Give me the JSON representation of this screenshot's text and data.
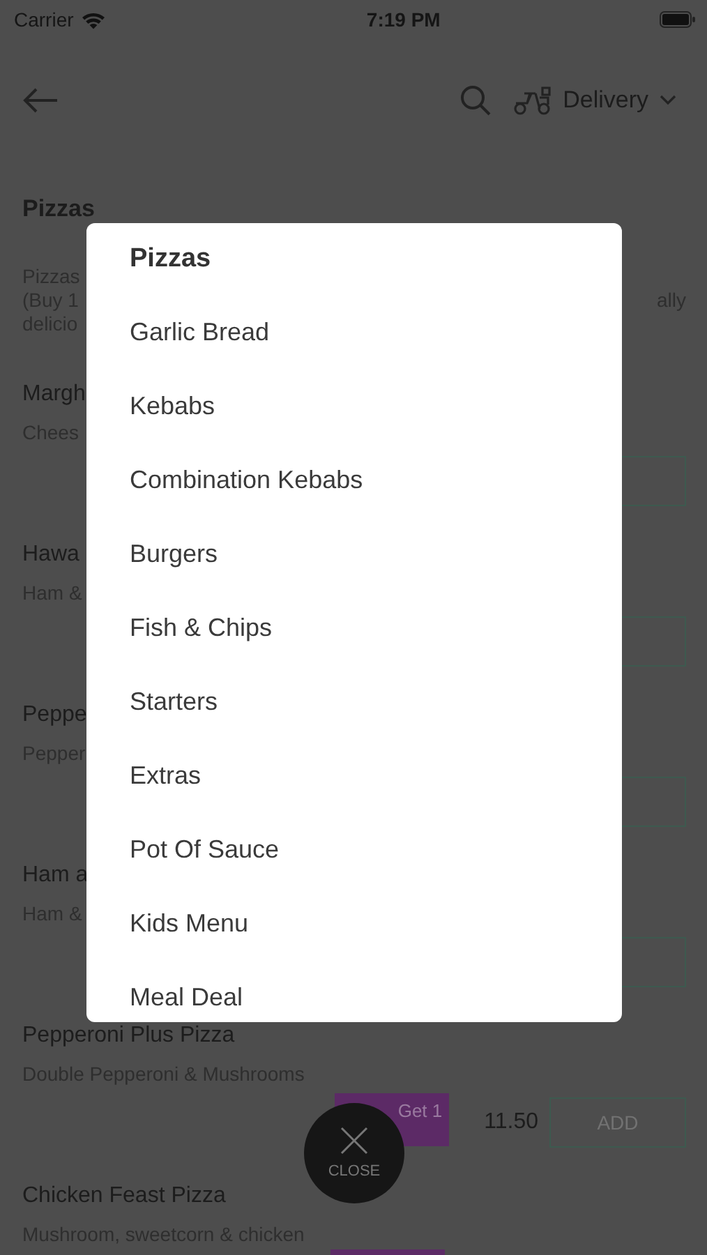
{
  "status_bar": {
    "carrier": "Carrier",
    "time": "7:19 PM"
  },
  "nav": {
    "mode": "Delivery"
  },
  "section": {
    "title": "Pizzas",
    "category": "Pizzas",
    "intro_lines": [
      "(Buy 1",
      "delicio"
    ],
    "intro_right": "ally"
  },
  "items": [
    {
      "name": "Margh",
      "description": "Chees"
    },
    {
      "name": "Hawa",
      "description": "Ham &"
    },
    {
      "name": "Peppe",
      "description": "Pepper"
    },
    {
      "name": "Ham a",
      "description": "Ham &"
    },
    {
      "name": "Pepperoni Plus Pizza",
      "description": "Double Pepperoni & Mushrooms",
      "promo": "Get 1",
      "price": "11.50",
      "add": "ADD"
    },
    {
      "name": "Chicken Feast Pizza",
      "description": "Mushroom, sweetcorn & chicken",
      "promo_badge": true
    }
  ],
  "menu_dialog": {
    "title": "Pizzas",
    "categories": [
      "Garlic Bread",
      "Kebabs",
      "Combination Kebabs",
      "Burgers",
      "Fish & Chips",
      "Starters",
      "Extras",
      "Pot Of Sauce",
      "Kids Menu",
      "Meal Deal"
    ]
  },
  "close_button": {
    "label": "CLOSE"
  }
}
